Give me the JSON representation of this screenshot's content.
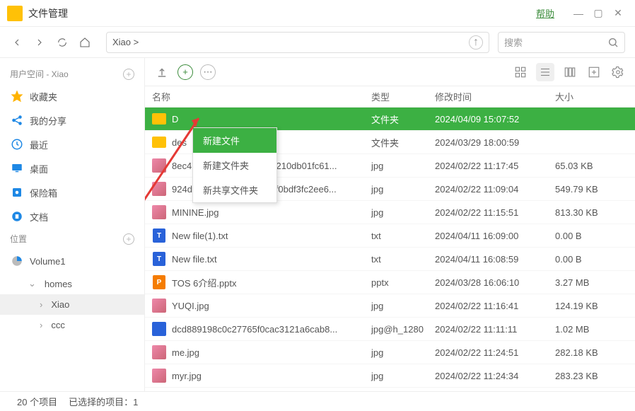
{
  "window": {
    "title": "文件管理",
    "help": "帮助"
  },
  "nav": {
    "path": "Xiao >"
  },
  "search": {
    "placeholder": "搜索"
  },
  "sidebar": {
    "user_header": "用户空间 - Xiao",
    "items": [
      {
        "icon": "star",
        "label": "收藏夹"
      },
      {
        "icon": "share",
        "label": "我的分享"
      },
      {
        "icon": "recent",
        "label": "最近"
      },
      {
        "icon": "desktop",
        "label": "桌面"
      },
      {
        "icon": "safe",
        "label": "保险箱"
      },
      {
        "icon": "docs",
        "label": "文档"
      }
    ],
    "loc_header": "位置",
    "volumes": [
      {
        "label": "Volume1",
        "children": [
          {
            "label": "homes",
            "children": [
              {
                "label": "Xiao",
                "selected": true
              },
              {
                "label": "ccc"
              }
            ]
          }
        ]
      }
    ]
  },
  "columns": {
    "name": "名称",
    "type": "类型",
    "date": "修改时间",
    "size": "大小"
  },
  "context_menu": {
    "items": [
      {
        "label": "新建文件",
        "hl": true
      },
      {
        "label": "新建文件夹"
      },
      {
        "label": "新共享文件夹"
      }
    ]
  },
  "files": [
    {
      "name": "D",
      "type": "文件夹",
      "date": "2024/04/09 15:07:52",
      "size": "",
      "icon": "folder",
      "selected": true
    },
    {
      "name": "des",
      "type": "文件夹",
      "date": "2024/03/29 18:00:59",
      "size": "",
      "icon": "folder"
    },
    {
      "name": "8ec47e7a7058947487af7210db01fc61...",
      "type": "jpg",
      "date": "2024/02/22 11:17:45",
      "size": "65.03 KB",
      "icon": "thumb"
    },
    {
      "name": "924df6b66c9ba9d4c3e63f0bdf3fc2ee6...",
      "type": "jpg",
      "date": "2024/02/22 11:09:04",
      "size": "549.79 KB",
      "icon": "thumb"
    },
    {
      "name": "MININE.jpg",
      "type": "jpg",
      "date": "2024/02/22 11:15:51",
      "size": "813.30 KB",
      "icon": "thumb"
    },
    {
      "name": "New file(1).txt",
      "type": "txt",
      "date": "2024/04/11 16:09:00",
      "size": "0.00 B",
      "icon": "txt"
    },
    {
      "name": "New file.txt",
      "type": "txt",
      "date": "2024/04/11 16:08:59",
      "size": "0.00 B",
      "icon": "txt"
    },
    {
      "name": "TOS 6介绍.pptx",
      "type": "pptx",
      "date": "2024/03/28 16:06:10",
      "size": "3.27 MB",
      "icon": "pptx"
    },
    {
      "name": "YUQI.jpg",
      "type": "jpg",
      "date": "2024/02/22 11:16:41",
      "size": "124.19 KB",
      "icon": "thumb"
    },
    {
      "name": "dcd889198c0c27765f0cac3121a6cab8...",
      "type": "jpg@h_1280",
      "date": "2024/02/22 11:11:11",
      "size": "1.02 MB",
      "icon": "thumb2"
    },
    {
      "name": "me.jpg",
      "type": "jpg",
      "date": "2024/02/22 11:24:51",
      "size": "282.18 KB",
      "icon": "thumb"
    },
    {
      "name": "myr.jpg",
      "type": "jpg",
      "date": "2024/02/22 11:24:34",
      "size": "283.23 KB",
      "icon": "thumb"
    }
  ],
  "status": {
    "count": "20 个项目",
    "selected": "已选择的项目：1"
  }
}
